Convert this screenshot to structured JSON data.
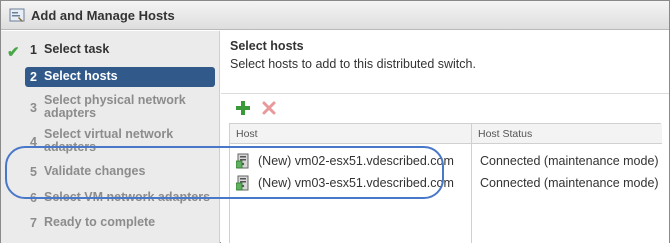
{
  "window": {
    "title": "Add and Manage Hosts",
    "icon": "wizard-icon"
  },
  "steps": [
    {
      "num": "1",
      "label": "Select task",
      "state": "done"
    },
    {
      "num": "2",
      "label": "Select hosts",
      "state": "active"
    },
    {
      "num": "3",
      "label": "Select physical network adapters",
      "state": "pending"
    },
    {
      "num": "4",
      "label": "Select virtual network adapters",
      "state": "pending"
    },
    {
      "num": "5",
      "label": "Validate changes",
      "state": "pending"
    },
    {
      "num": "6",
      "label": "Select VM network adapters",
      "state": "pending"
    },
    {
      "num": "7",
      "label": "Ready to complete",
      "state": "pending"
    }
  ],
  "main": {
    "heading": "Select hosts",
    "subtext": "Select hosts to add to this distributed switch."
  },
  "toolbar": {
    "add_icon": "add-plus-icon",
    "remove_icon": "remove-x-icon"
  },
  "grid": {
    "columns": [
      "Host",
      "Host Status"
    ],
    "rows": [
      {
        "host": "(New) vm02-esx51.vdescribed.com",
        "status": "Connected (maintenance mode)"
      },
      {
        "host": "(New) vm03-esx51.vdescribed.com",
        "status": "Connected (maintenance mode)"
      }
    ]
  },
  "colors": {
    "active_step_bg": "#315a8a",
    "check_green": "#48a848",
    "highlight_blue": "#4a78c8"
  }
}
